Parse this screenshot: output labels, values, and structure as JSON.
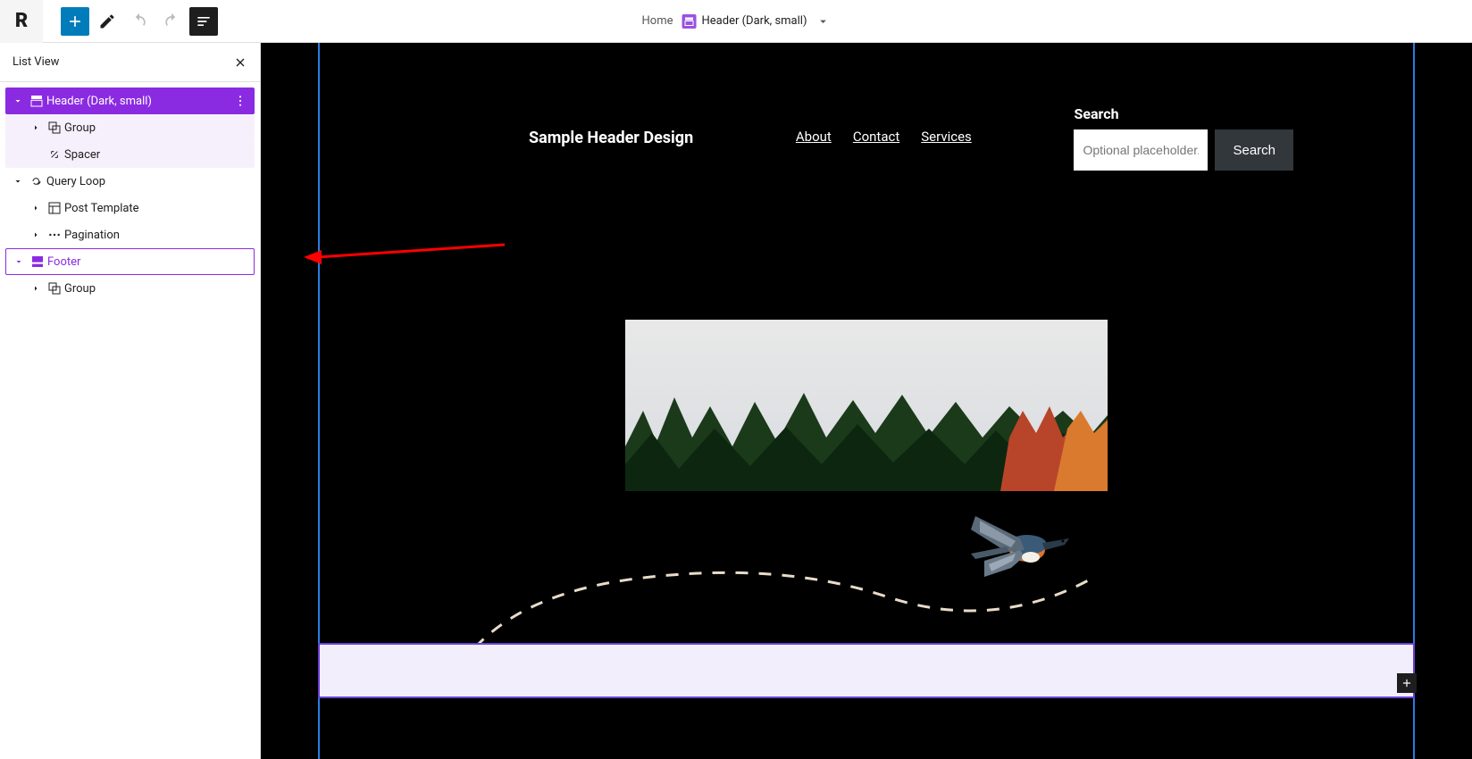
{
  "topbar": {
    "logo": "R"
  },
  "breadcrumb": {
    "root": "Home",
    "current": "Header (Dark, small)"
  },
  "panel": {
    "title": "List View",
    "tree": [
      {
        "label": "Header (Dark, small)"
      },
      {
        "label": "Group"
      },
      {
        "label": "Spacer"
      },
      {
        "label": "Query Loop"
      },
      {
        "label": "Post Template"
      },
      {
        "label": "Pagination"
      },
      {
        "label": "Footer"
      },
      {
        "label": "Group"
      }
    ]
  },
  "preview": {
    "site_title": "Sample Header Design",
    "nav": {
      "about": "About",
      "contact": "Contact",
      "services": "Services"
    },
    "search": {
      "label": "Search",
      "placeholder": "Optional placeholder...",
      "button": "Search"
    }
  }
}
